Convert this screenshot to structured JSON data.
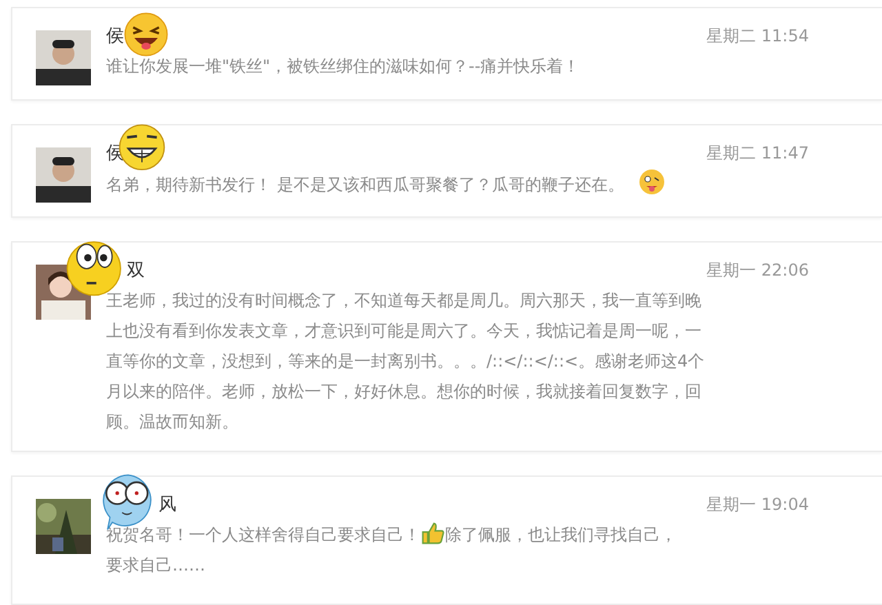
{
  "comments": [
    {
      "name": "侯",
      "time": "星期二 11:54",
      "segments": [
        {
          "kind": "text",
          "text": "谁让你发展一堆\"铁丝\"，被铁丝绑住的滋味如何？--痛并快乐着！"
        }
      ]
    },
    {
      "name": "侯",
      "time": "星期二 11:47",
      "segments": [
        {
          "kind": "text",
          "text": "名弟，期待新书发行！ 是不是又该和西瓜哥聚餐了？瓜哥的鞭子还在。"
        },
        {
          "kind": "tongue-emoji"
        }
      ]
    },
    {
      "name": "双",
      "time": "星期一 22:06",
      "segments": [
        {
          "kind": "text",
          "text": "王老师，我过的没有时间概念了，不知道每天都是周几。周六那天，我一直等到晚上也没有看到你发表文章，才意识到可能是周六了。今天，我惦记着是周一呢，一直等你的文章，没想到，等来的是一封离别书。。。/::</::</::<。感谢老师这4个月以来的陪伴。老师，放松一下，好好休息。想你的时候，我就接着回复数字，回顾。温故而知新。"
        }
      ]
    },
    {
      "name": "风",
      "time": "星期一 19:04",
      "segments": [
        {
          "kind": "text",
          "text": "祝贺名哥！一个人这样舍得自己要求自己！"
        },
        {
          "kind": "thumbs-up"
        },
        {
          "kind": "text",
          "text": "除了佩服，也让我们寻找自己，"
        },
        {
          "kind": "line",
          "text": "要求自己……"
        }
      ]
    }
  ]
}
